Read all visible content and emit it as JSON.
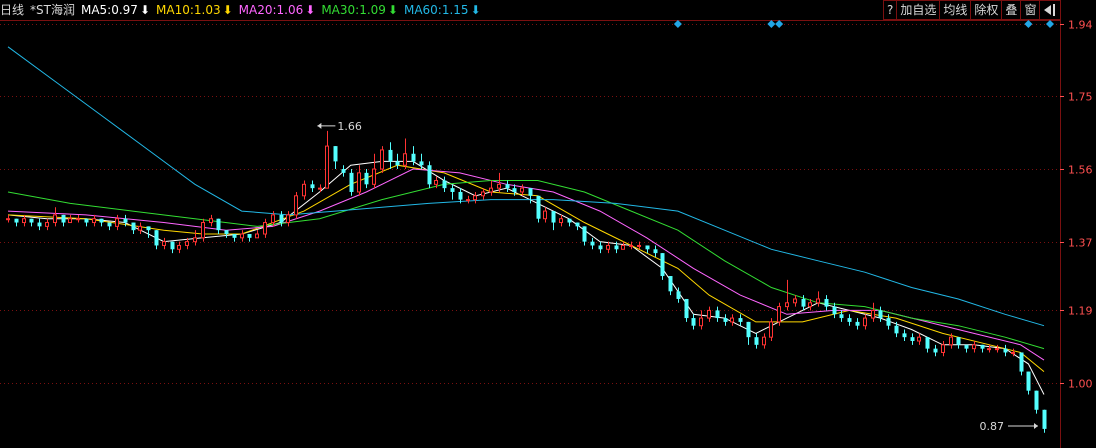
{
  "header": {
    "period": "日线",
    "stock": "*ST海润",
    "ma": [
      {
        "label": "MA5: ",
        "value": "0.97",
        "arrow": "⬇",
        "color": "#ffffff"
      },
      {
        "label": "MA10: ",
        "value": "1.03",
        "arrow": "⬇",
        "color": "#ffd700"
      },
      {
        "label": "MA20: ",
        "value": "1.06",
        "arrow": "⬇",
        "color": "#ff66ff"
      },
      {
        "label": "MA30: ",
        "value": "1.09",
        "arrow": "⬇",
        "color": "#33dd33"
      },
      {
        "label": "MA60: ",
        "value": "1.15",
        "arrow": "⬇",
        "color": "#22b8e6"
      }
    ]
  },
  "toolbar": {
    "help_label": "?",
    "add_fav_label": "加自选",
    "avg_line_label": "均线",
    "exright_label": "除权",
    "overlay_label": "叠",
    "window_label": "窗",
    "exit_icon": "exit-icon"
  },
  "colors": {
    "up": "#ff3333",
    "down": "#54ffff",
    "grid": "#7a1010",
    "axis_text": "#ff5050"
  },
  "chart_data": {
    "type": "candlestick",
    "y_ticks": [
      "1.94",
      "1.75",
      "1.56",
      "1.37",
      "1.19",
      "1.00"
    ],
    "ylim": [
      0.83,
      1.95
    ],
    "annotations": {
      "high_label": "1.66",
      "low_label": "0.87"
    },
    "candles": [
      [
        1.43,
        1.43,
        1.44,
        1.42
      ],
      [
        1.43,
        1.42,
        1.43,
        1.41
      ],
      [
        1.42,
        1.43,
        1.44,
        1.41
      ],
      [
        1.43,
        1.42,
        1.43,
        1.41
      ],
      [
        1.42,
        1.41,
        1.43,
        1.4
      ],
      [
        1.41,
        1.42,
        1.43,
        1.4
      ],
      [
        1.42,
        1.44,
        1.46,
        1.41
      ],
      [
        1.44,
        1.42,
        1.44,
        1.41
      ],
      [
        1.42,
        1.43,
        1.44,
        1.42
      ],
      [
        1.43,
        1.43,
        1.44,
        1.42
      ],
      [
        1.43,
        1.42,
        1.43,
        1.41
      ],
      [
        1.42,
        1.43,
        1.44,
        1.41
      ],
      [
        1.43,
        1.42,
        1.43,
        1.41
      ],
      [
        1.42,
        1.41,
        1.42,
        1.4
      ],
      [
        1.41,
        1.43,
        1.44,
        1.4
      ],
      [
        1.43,
        1.42,
        1.44,
        1.41
      ],
      [
        1.42,
        1.4,
        1.42,
        1.39
      ],
      [
        1.4,
        1.41,
        1.42,
        1.39
      ],
      [
        1.41,
        1.4,
        1.41,
        1.38
      ],
      [
        1.4,
        1.36,
        1.4,
        1.35
      ],
      [
        1.36,
        1.37,
        1.38,
        1.35
      ],
      [
        1.37,
        1.35,
        1.37,
        1.34
      ],
      [
        1.35,
        1.36,
        1.37,
        1.34
      ],
      [
        1.36,
        1.37,
        1.38,
        1.35
      ],
      [
        1.37,
        1.38,
        1.4,
        1.36
      ],
      [
        1.38,
        1.42,
        1.43,
        1.37
      ],
      [
        1.42,
        1.43,
        1.44,
        1.41
      ],
      [
        1.43,
        1.4,
        1.43,
        1.39
      ],
      [
        1.4,
        1.39,
        1.4,
        1.38
      ],
      [
        1.39,
        1.38,
        1.39,
        1.37
      ],
      [
        1.38,
        1.39,
        1.4,
        1.37
      ],
      [
        1.39,
        1.38,
        1.39,
        1.37
      ],
      [
        1.38,
        1.39,
        1.4,
        1.38
      ],
      [
        1.39,
        1.42,
        1.43,
        1.38
      ],
      [
        1.42,
        1.44,
        1.45,
        1.41
      ],
      [
        1.44,
        1.42,
        1.45,
        1.41
      ],
      [
        1.42,
        1.44,
        1.45,
        1.41
      ],
      [
        1.44,
        1.49,
        1.5,
        1.43
      ],
      [
        1.49,
        1.52,
        1.53,
        1.48
      ],
      [
        1.52,
        1.51,
        1.53,
        1.5
      ],
      [
        1.51,
        1.51,
        1.52,
        1.5
      ],
      [
        1.51,
        1.62,
        1.66,
        1.51
      ],
      [
        1.62,
        1.58,
        1.62,
        1.56
      ],
      [
        1.56,
        1.55,
        1.57,
        1.54
      ],
      [
        1.55,
        1.5,
        1.56,
        1.49
      ],
      [
        1.5,
        1.55,
        1.57,
        1.49
      ],
      [
        1.55,
        1.52,
        1.56,
        1.51
      ],
      [
        1.52,
        1.56,
        1.6,
        1.51
      ],
      [
        1.56,
        1.61,
        1.62,
        1.55
      ],
      [
        1.61,
        1.58,
        1.63,
        1.56
      ],
      [
        1.58,
        1.57,
        1.6,
        1.56
      ],
      [
        1.57,
        1.6,
        1.64,
        1.56
      ],
      [
        1.6,
        1.58,
        1.62,
        1.57
      ],
      [
        1.58,
        1.57,
        1.6,
        1.56
      ],
      [
        1.57,
        1.52,
        1.58,
        1.51
      ],
      [
        1.52,
        1.53,
        1.54,
        1.51
      ],
      [
        1.53,
        1.51,
        1.54,
        1.5
      ],
      [
        1.51,
        1.5,
        1.52,
        1.48
      ],
      [
        1.5,
        1.48,
        1.51,
        1.47
      ],
      [
        1.48,
        1.48,
        1.49,
        1.47
      ],
      [
        1.48,
        1.49,
        1.5,
        1.47
      ],
      [
        1.49,
        1.5,
        1.51,
        1.48
      ],
      [
        1.5,
        1.51,
        1.53,
        1.49
      ],
      [
        1.51,
        1.52,
        1.55,
        1.5
      ],
      [
        1.52,
        1.51,
        1.53,
        1.5
      ],
      [
        1.51,
        1.5,
        1.52,
        1.49
      ],
      [
        1.5,
        1.51,
        1.52,
        1.49
      ],
      [
        1.51,
        1.49,
        1.51,
        1.47
      ],
      [
        1.49,
        1.43,
        1.49,
        1.42
      ],
      [
        1.43,
        1.45,
        1.46,
        1.42
      ],
      [
        1.45,
        1.42,
        1.45,
        1.4
      ],
      [
        1.42,
        1.43,
        1.44,
        1.41
      ],
      [
        1.43,
        1.42,
        1.43,
        1.41
      ],
      [
        1.42,
        1.41,
        1.42,
        1.4
      ],
      [
        1.41,
        1.37,
        1.41,
        1.36
      ],
      [
        1.37,
        1.36,
        1.38,
        1.35
      ],
      [
        1.36,
        1.35,
        1.37,
        1.34
      ],
      [
        1.35,
        1.36,
        1.37,
        1.34
      ],
      [
        1.36,
        1.35,
        1.37,
        1.34
      ],
      [
        1.35,
        1.36,
        1.37,
        1.35
      ],
      [
        1.36,
        1.36,
        1.37,
        1.35
      ],
      [
        1.36,
        1.36,
        1.37,
        1.35
      ],
      [
        1.36,
        1.35,
        1.36,
        1.34
      ],
      [
        1.35,
        1.34,
        1.36,
        1.33
      ],
      [
        1.34,
        1.28,
        1.34,
        1.27
      ],
      [
        1.28,
        1.24,
        1.28,
        1.23
      ],
      [
        1.24,
        1.22,
        1.25,
        1.21
      ],
      [
        1.22,
        1.17,
        1.22,
        1.16
      ],
      [
        1.17,
        1.15,
        1.18,
        1.14
      ],
      [
        1.15,
        1.17,
        1.19,
        1.14
      ],
      [
        1.17,
        1.19,
        1.2,
        1.16
      ],
      [
        1.19,
        1.17,
        1.2,
        1.16
      ],
      [
        1.17,
        1.16,
        1.18,
        1.15
      ],
      [
        1.16,
        1.17,
        1.18,
        1.15
      ],
      [
        1.17,
        1.16,
        1.18,
        1.15
      ],
      [
        1.16,
        1.12,
        1.16,
        1.1
      ],
      [
        1.12,
        1.1,
        1.13,
        1.09
      ],
      [
        1.1,
        1.12,
        1.13,
        1.09
      ],
      [
        1.12,
        1.16,
        1.17,
        1.11
      ],
      [
        1.16,
        1.2,
        1.21,
        1.15
      ],
      [
        1.2,
        1.21,
        1.27,
        1.19
      ],
      [
        1.21,
        1.22,
        1.23,
        1.2
      ],
      [
        1.22,
        1.2,
        1.23,
        1.19
      ],
      [
        1.2,
        1.21,
        1.22,
        1.19
      ],
      [
        1.21,
        1.22,
        1.24,
        1.2
      ],
      [
        1.22,
        1.2,
        1.23,
        1.19
      ],
      [
        1.2,
        1.18,
        1.21,
        1.17
      ],
      [
        1.18,
        1.17,
        1.19,
        1.16
      ],
      [
        1.17,
        1.16,
        1.18,
        1.15
      ],
      [
        1.16,
        1.15,
        1.17,
        1.14
      ],
      [
        1.15,
        1.17,
        1.18,
        1.14
      ],
      [
        1.17,
        1.19,
        1.21,
        1.16
      ],
      [
        1.19,
        1.17,
        1.2,
        1.16
      ],
      [
        1.17,
        1.15,
        1.18,
        1.14
      ],
      [
        1.15,
        1.13,
        1.16,
        1.12
      ],
      [
        1.13,
        1.12,
        1.14,
        1.11
      ],
      [
        1.12,
        1.11,
        1.13,
        1.1
      ],
      [
        1.11,
        1.12,
        1.13,
        1.1
      ],
      [
        1.12,
        1.09,
        1.12,
        1.08
      ],
      [
        1.09,
        1.08,
        1.1,
        1.07
      ],
      [
        1.08,
        1.1,
        1.11,
        1.07
      ],
      [
        1.1,
        1.12,
        1.13,
        1.09
      ],
      [
        1.12,
        1.1,
        1.12,
        1.09
      ],
      [
        1.1,
        1.09,
        1.1,
        1.08
      ],
      [
        1.09,
        1.1,
        1.11,
        1.08
      ],
      [
        1.1,
        1.09,
        1.1,
        1.08
      ],
      [
        1.09,
        1.09,
        1.1,
        1.08
      ],
      [
        1.09,
        1.09,
        1.1,
        1.08
      ],
      [
        1.09,
        1.08,
        1.1,
        1.07
      ],
      [
        1.08,
        1.08,
        1.09,
        1.07
      ],
      [
        1.08,
        1.03,
        1.08,
        1.02
      ],
      [
        1.03,
        0.98,
        1.03,
        0.97
      ],
      [
        0.98,
        0.93,
        0.98,
        0.92
      ],
      [
        0.93,
        0.88,
        0.93,
        0.87
      ]
    ],
    "ma_series": [
      {
        "name": "MA5",
        "color": "#ffffff",
        "values": [
          [
            0,
            1.44
          ],
          [
            5,
            1.43
          ],
          [
            10,
            1.43
          ],
          [
            15,
            1.42
          ],
          [
            20,
            1.37
          ],
          [
            25,
            1.38
          ],
          [
            30,
            1.39
          ],
          [
            35,
            1.42
          ],
          [
            40,
            1.5
          ],
          [
            44,
            1.57
          ],
          [
            48,
            1.58
          ],
          [
            52,
            1.58
          ],
          [
            56,
            1.53
          ],
          [
            60,
            1.49
          ],
          [
            64,
            1.51
          ],
          [
            68,
            1.47
          ],
          [
            72,
            1.43
          ],
          [
            76,
            1.37
          ],
          [
            80,
            1.36
          ],
          [
            84,
            1.3
          ],
          [
            88,
            1.18
          ],
          [
            92,
            1.17
          ],
          [
            96,
            1.13
          ],
          [
            100,
            1.17
          ],
          [
            104,
            1.21
          ],
          [
            108,
            1.19
          ],
          [
            112,
            1.17
          ],
          [
            116,
            1.14
          ],
          [
            120,
            1.1
          ],
          [
            124,
            1.1
          ],
          [
            128,
            1.09
          ],
          [
            131,
            1.05
          ],
          [
            133,
            0.97
          ]
        ]
      },
      {
        "name": "MA10",
        "color": "#ffd700",
        "values": [
          [
            0,
            1.44
          ],
          [
            10,
            1.43
          ],
          [
            20,
            1.4
          ],
          [
            25,
            1.39
          ],
          [
            30,
            1.39
          ],
          [
            38,
            1.45
          ],
          [
            44,
            1.52
          ],
          [
            50,
            1.57
          ],
          [
            56,
            1.55
          ],
          [
            62,
            1.5
          ],
          [
            68,
            1.49
          ],
          [
            74,
            1.42
          ],
          [
            80,
            1.36
          ],
          [
            86,
            1.3
          ],
          [
            90,
            1.23
          ],
          [
            96,
            1.16
          ],
          [
            102,
            1.16
          ],
          [
            108,
            1.19
          ],
          [
            114,
            1.17
          ],
          [
            120,
            1.13
          ],
          [
            126,
            1.1
          ],
          [
            130,
            1.08
          ],
          [
            133,
            1.03
          ]
        ]
      },
      {
        "name": "MA20",
        "color": "#ff66ff",
        "values": [
          [
            0,
            1.45
          ],
          [
            10,
            1.44
          ],
          [
            20,
            1.42
          ],
          [
            28,
            1.4
          ],
          [
            34,
            1.41
          ],
          [
            40,
            1.45
          ],
          [
            46,
            1.5
          ],
          [
            52,
            1.56
          ],
          [
            58,
            1.55
          ],
          [
            64,
            1.52
          ],
          [
            70,
            1.5
          ],
          [
            76,
            1.45
          ],
          [
            82,
            1.38
          ],
          [
            88,
            1.3
          ],
          [
            94,
            1.23
          ],
          [
            100,
            1.18
          ],
          [
            106,
            1.19
          ],
          [
            112,
            1.19
          ],
          [
            118,
            1.16
          ],
          [
            124,
            1.13
          ],
          [
            130,
            1.1
          ],
          [
            133,
            1.06
          ]
        ]
      },
      {
        "name": "MA30",
        "color": "#33dd33",
        "values": [
          [
            0,
            1.5
          ],
          [
            8,
            1.47
          ],
          [
            16,
            1.45
          ],
          [
            24,
            1.43
          ],
          [
            32,
            1.41
          ],
          [
            40,
            1.43
          ],
          [
            48,
            1.48
          ],
          [
            56,
            1.52
          ],
          [
            62,
            1.53
          ],
          [
            68,
            1.53
          ],
          [
            74,
            1.5
          ],
          [
            80,
            1.45
          ],
          [
            86,
            1.4
          ],
          [
            92,
            1.32
          ],
          [
            98,
            1.25
          ],
          [
            104,
            1.21
          ],
          [
            110,
            1.2
          ],
          [
            116,
            1.17
          ],
          [
            122,
            1.15
          ],
          [
            128,
            1.12
          ],
          [
            133,
            1.09
          ]
        ]
      },
      {
        "name": "MA60",
        "color": "#22b8e6",
        "values": [
          [
            0,
            1.88
          ],
          [
            6,
            1.79
          ],
          [
            12,
            1.7
          ],
          [
            18,
            1.61
          ],
          [
            24,
            1.52
          ],
          [
            30,
            1.45
          ],
          [
            36,
            1.44
          ],
          [
            42,
            1.45
          ],
          [
            48,
            1.46
          ],
          [
            54,
            1.47
          ],
          [
            62,
            1.48
          ],
          [
            70,
            1.48
          ],
          [
            78,
            1.47
          ],
          [
            86,
            1.45
          ],
          [
            92,
            1.4
          ],
          [
            98,
            1.35
          ],
          [
            104,
            1.32
          ],
          [
            110,
            1.29
          ],
          [
            116,
            1.25
          ],
          [
            122,
            1.22
          ],
          [
            128,
            1.18
          ],
          [
            133,
            1.15
          ]
        ]
      }
    ],
    "markers_x": [
      86,
      98,
      99,
      131,
      134
    ]
  }
}
